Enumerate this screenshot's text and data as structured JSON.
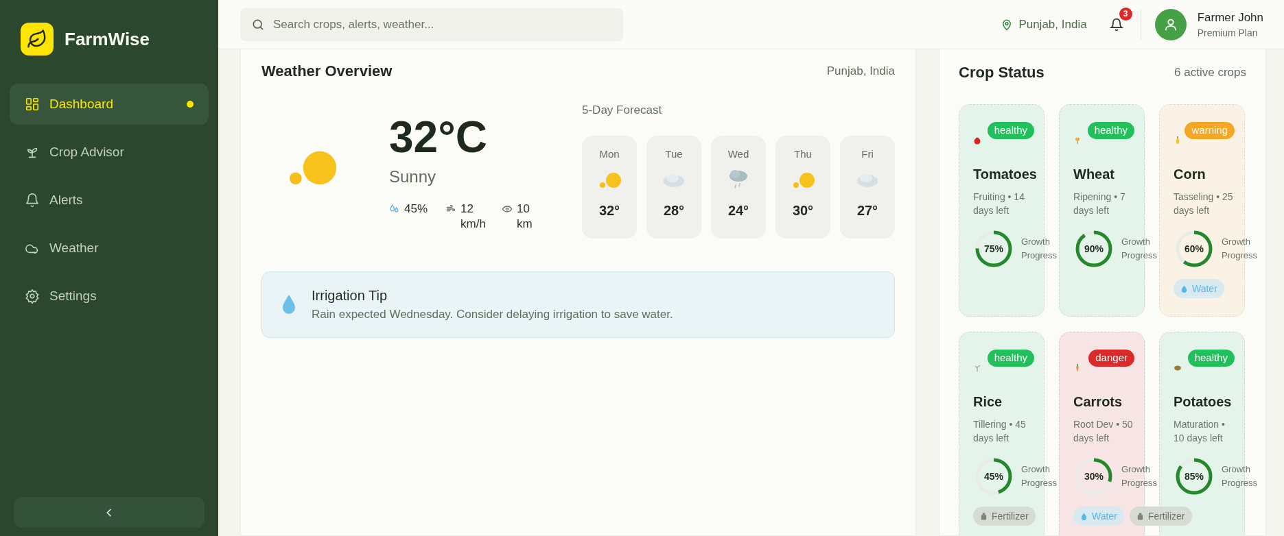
{
  "sidebar": {
    "brand": "FarmWise",
    "items": [
      {
        "label": "Dashboard",
        "selected": true
      },
      {
        "label": "Crop Advisor",
        "selected": false
      },
      {
        "label": "Alerts",
        "selected": false
      },
      {
        "label": "Weather",
        "selected": false
      },
      {
        "label": "Settings",
        "selected": false
      }
    ]
  },
  "header": {
    "search": {
      "placeholder": "Search crops, alerts, weather..."
    },
    "location": "Punjab, India",
    "notifications": "3",
    "user": {
      "name": "Farmer John",
      "plan": "Premium Plan"
    }
  },
  "weather": {
    "title": "Weather Overview",
    "location": "Punjab, India",
    "temperature": "32°C",
    "condition": "Sunny",
    "kind": "sunny",
    "stats": [
      {
        "kind": "humidity",
        "value": "45%"
      },
      {
        "kind": "wind",
        "value": "12 km/h"
      },
      {
        "kind": "visibility",
        "value": "10 km"
      }
    ],
    "forecast_title": "5-Day Forecast",
    "forecast": [
      {
        "day": "Mon",
        "kind": "sunny",
        "temp": "32°"
      },
      {
        "day": "Tue",
        "kind": "cloudy",
        "temp": "28°"
      },
      {
        "day": "Wed",
        "kind": "rain",
        "temp": "24°"
      },
      {
        "day": "Thu",
        "kind": "sunny",
        "temp": "30°"
      },
      {
        "day": "Fri",
        "kind": "cloudy",
        "temp": "27°"
      }
    ],
    "tip": {
      "title": "Irrigation Tip",
      "text": "Rain expected Wednesday. Consider delaying irrigation to save water."
    }
  },
  "crops": {
    "title": "Crop Status",
    "count": "6 active crops",
    "cards": [
      {
        "name": "Tomatoes",
        "status": "healthy",
        "color": "#22c05a",
        "stage": "Fruiting • 14 days left",
        "level": 0.75,
        "percent": "75%",
        "progress_label": "Growth Progress"
      },
      {
        "name": "Wheat",
        "status": "healthy",
        "color": "#22c05a",
        "stage": "Ripening • 7 days left",
        "level": 0.9,
        "percent": "90%",
        "progress_label": "Growth Progress"
      },
      {
        "name": "Corn",
        "status": "warning",
        "color": "#f5a623",
        "stage": "Tasseling • 25 days left",
        "level": 0.6,
        "percent": "60%",
        "progress_label": "Growth Progress",
        "tags": [
          {
            "kind": "water",
            "label": "Water"
          }
        ]
      },
      {
        "name": "Rice",
        "status": "healthy",
        "color": "#22c05a",
        "stage": "Tillering • 45 days left",
        "level": 0.45,
        "percent": "45%",
        "progress_label": "Growth Progress",
        "tags": [
          {
            "kind": "fertilizer",
            "label": "Fertilizer"
          }
        ]
      },
      {
        "name": "Carrots",
        "status": "danger",
        "color": "#dc2a2a",
        "stage": "Root Dev • 50 days left",
        "level": 0.3,
        "percent": "30%",
        "progress_label": "Growth Progress",
        "tags": [
          {
            "kind": "water",
            "label": "Water"
          },
          {
            "kind": "fertilizer",
            "label": "Fertilizer"
          }
        ]
      },
      {
        "name": "Potatoes",
        "status": "healthy",
        "color": "#22c05a",
        "stage": "Maturation • 10 days left",
        "level": 0.85,
        "percent": "85%",
        "progress_label": "Growth Progress"
      }
    ]
  }
}
